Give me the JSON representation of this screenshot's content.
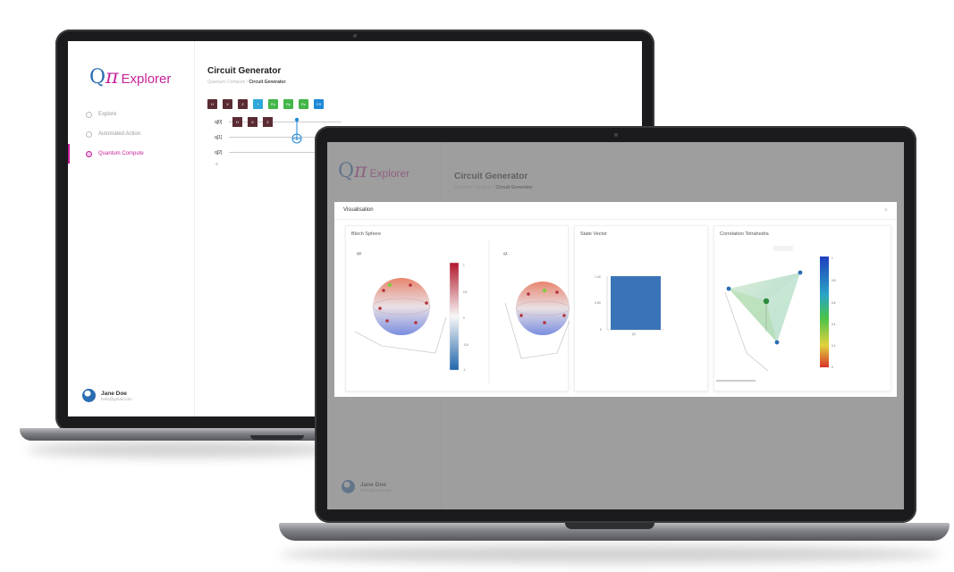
{
  "app": {
    "logo": {
      "q": "Q",
      "pi": "π",
      "word": "Explorer"
    },
    "nav": [
      {
        "label": "Explore",
        "active": false
      },
      {
        "label": "Automated Action",
        "active": false
      },
      {
        "label": "Quantum Compute",
        "active": true
      }
    ],
    "user": {
      "name": "Jane Doe",
      "email": "hello@gmail.com"
    },
    "page_title": "Circuit Generator",
    "breadcrumb": {
      "parent": "Quantum Compute",
      "separator": " / ",
      "current": "Circuit Generator"
    }
  },
  "palette": [
    {
      "label": "H",
      "color": "#5a2b32"
    },
    {
      "label": "X",
      "color": "#5a2b32"
    },
    {
      "label": "Z",
      "color": "#5a2b32"
    },
    {
      "label": "I",
      "color": "#2ea8d8"
    },
    {
      "label": "Rx",
      "color": "#43b649"
    },
    {
      "label": "Ry",
      "color": "#43b649"
    },
    {
      "label": "Rz",
      "color": "#43b649"
    },
    {
      "label": "CX",
      "color": "#1e88d8"
    }
  ],
  "circuit": {
    "qubits": [
      "q[0]",
      "q[1]",
      "q[2]"
    ],
    "q0_gates": [
      "H",
      "X",
      "Z"
    ],
    "add_label": "+"
  },
  "modal": {
    "title": "Visualisation",
    "close": "×",
    "bloch": {
      "title": "Bloch Sphere",
      "q0_label": "q0",
      "q1_label": "q1",
      "colorbar_ticks": [
        "1",
        "0.5",
        "0",
        "-0.5",
        "-1"
      ]
    },
    "statevector": {
      "title": "State Vector",
      "y_ticks": [
        "1.00",
        "0.50",
        "0"
      ],
      "x_tick": "|0⟩"
    },
    "tetrahedron": {
      "title": "Correlation Tetrahedra",
      "colorbar_ticks": [
        "1",
        "0.8",
        "0.6",
        "0.4",
        "0.2",
        "0"
      ]
    }
  },
  "colors": {
    "brand": "#c8239a",
    "accent": "#2b6db3"
  }
}
